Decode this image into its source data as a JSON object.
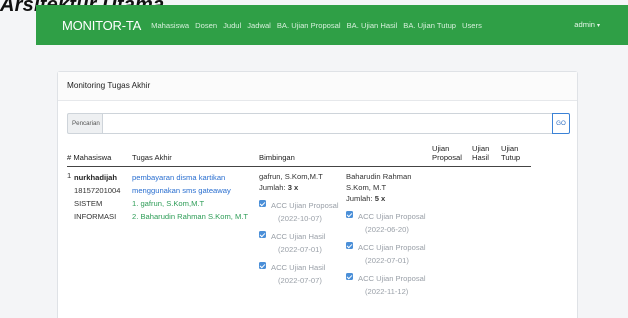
{
  "page_heading": "Arsitektur Utama",
  "nav": {
    "brand": "MONITOR-TA",
    "links": [
      "Mahasiswa",
      "Dosen",
      "Judul",
      "Jadwal",
      "BA. Ujian Proposal",
      "BA. Ujian Hasil",
      "BA. Ujian Tutup",
      "Users"
    ],
    "user": "admin"
  },
  "card": {
    "title": "Monitoring Tugas Akhir",
    "search_label": "Pencarian",
    "search_value": "",
    "go_label": "GO"
  },
  "table": {
    "headers": {
      "no_mhs": "# Mahasiswa",
      "tugas_akhir": "Tugas Akhir",
      "bimbingan": "Bimbingan",
      "ujian_proposal": "Ujian Proposal",
      "ujian_hasil": "Ujian Hasil",
      "ujian_tutup": "Ujian Tutup"
    },
    "rows": [
      {
        "no": "1",
        "nama": "nurkhadijah",
        "nim": "18157201004",
        "prodi_1": "SISTEM",
        "prodi_2": "INFORMASI",
        "judul": "pembayaran disma kartikan menggunakan sms gateaway",
        "pembimbing_1": "1. gafrun, S.Kom,M.T",
        "pembimbing_2": "2. Baharudin Rahman S.Kom, M.T",
        "bimbingan": [
          {
            "dosen": "gafrun, S.Kom,M.T",
            "jumlah_label": "Jumlah:",
            "jumlah": "3 x",
            "acc": [
              {
                "label": "ACC Ujian Proposal",
                "date": "(2022-10-07)"
              },
              {
                "label": "ACC Ujian Hasil",
                "date": "(2022-07-01)"
              },
              {
                "label": "ACC Ujian Hasil",
                "date": "(2022-07-07)"
              }
            ]
          },
          {
            "dosen": "Baharudin Rahman S.Kom, M.T",
            "jumlah_label": "Jumlah:",
            "jumlah": "5 x",
            "acc": [
              {
                "label": "ACC Ujian Proposal",
                "date": "(2022-06-20)"
              },
              {
                "label": "ACC Ujian Proposal",
                "date": "(2022-07-01)"
              },
              {
                "label": "ACC Ujian Proposal",
                "date": "(2022-11-12)"
              }
            ]
          }
        ]
      }
    ]
  },
  "colors": {
    "navbar": "#2f9f46",
    "link_blue": "#2a6fd0",
    "pembimbing_green": "#2e9d57",
    "check_blue": "#4a8fd8"
  }
}
